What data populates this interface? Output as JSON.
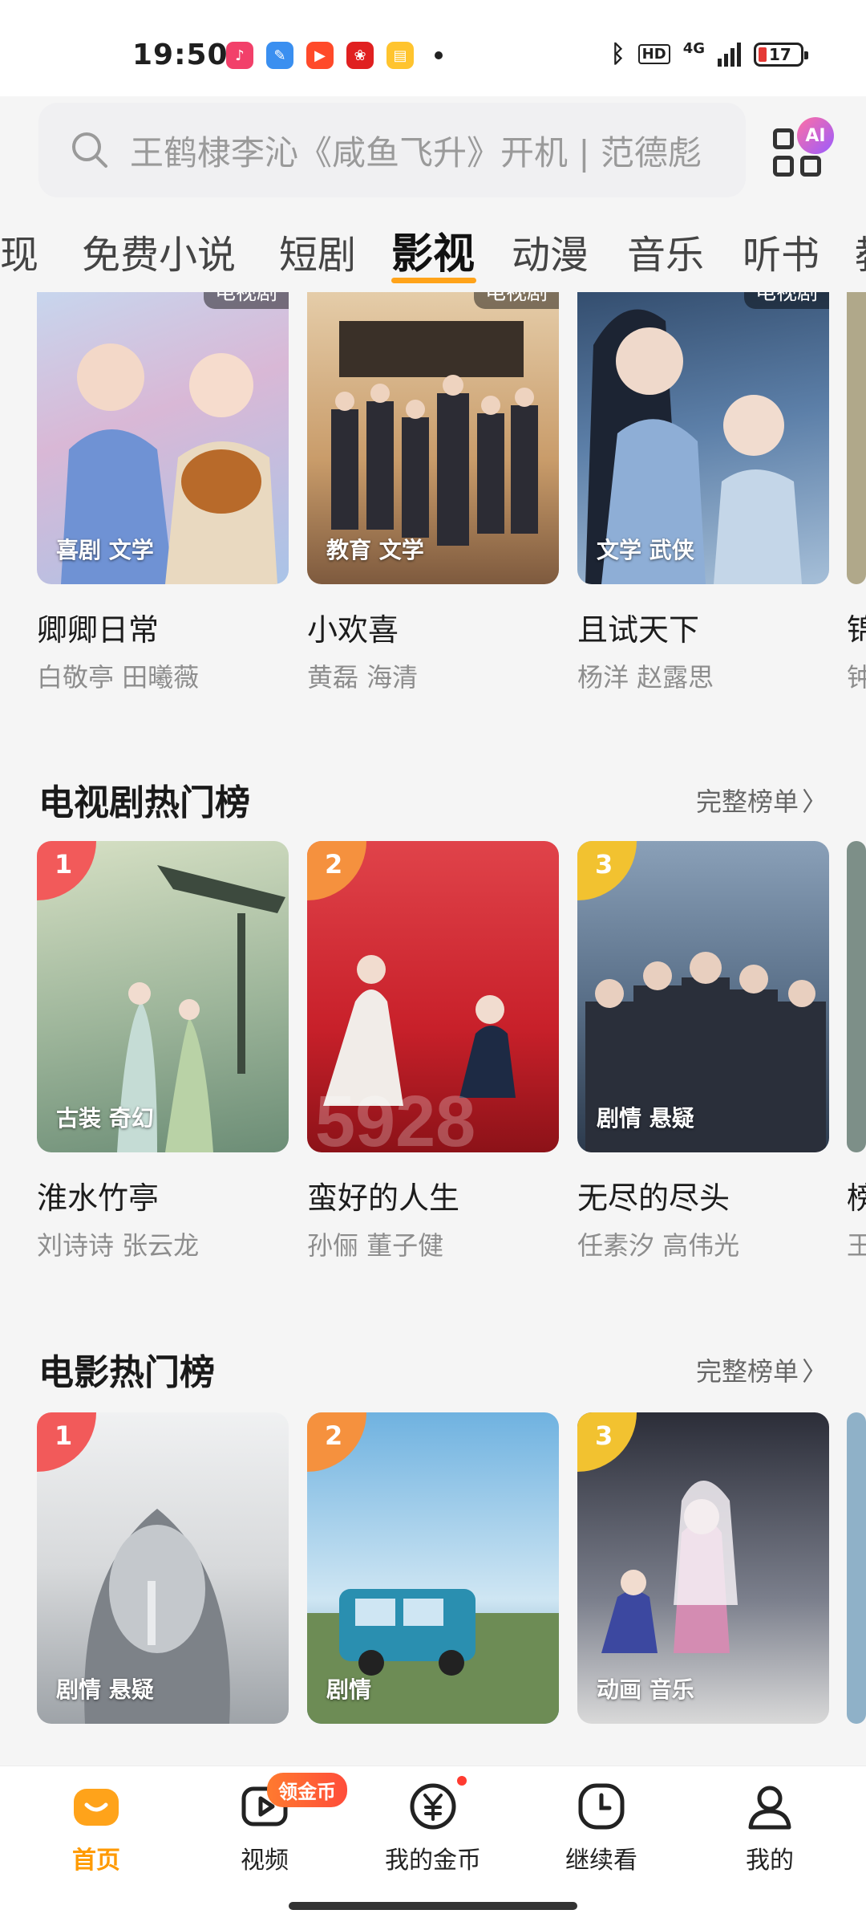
{
  "status_bar": {
    "time": "19:50",
    "network": "4G",
    "hd_label": "HD",
    "battery": "17",
    "app_icons": [
      "music-app-icon",
      "feather-app-icon",
      "video-app-icon",
      "pinduoduo-app-icon",
      "notes-app-icon"
    ]
  },
  "search": {
    "placeholder": "王鹤棣李沁《咸鱼飞升》开机 | 范德彪",
    "ai_badge": "AI"
  },
  "tabs": [
    "现",
    "免费小说",
    "短剧",
    "影视",
    "动漫",
    "音乐",
    "听书",
    "教"
  ],
  "active_tab": "影视",
  "top_row": {
    "items": [
      {
        "title": "卿卿日常",
        "cast": "白敬亭 田曦薇",
        "tags": "喜剧 文学",
        "badge": "电视剧",
        "colors": [
          "#a9c4e8",
          "#d9b8d6",
          "#c5d9f0"
        ]
      },
      {
        "title": "小欢喜",
        "cast": "黄磊 海清",
        "tags": "教育 文学",
        "badge": "电视剧",
        "colors": [
          "#c99c6a",
          "#e8d2b0",
          "#7e5a3e"
        ]
      },
      {
        "title": "且试天下",
        "cast": "杨洋 赵露思",
        "tags": "文学 武侠",
        "badge": "电视剧",
        "colors": [
          "#5c7fa8",
          "#a6bfd8",
          "#2f4868"
        ]
      },
      {
        "title": "锦",
        "cast": "钟"
      }
    ]
  },
  "tv_chart": {
    "heading": "电视剧热门榜",
    "more": "完整榜单",
    "items": [
      {
        "rank": "1",
        "title": "淮水竹亭",
        "cast": "刘诗诗 张云龙",
        "tags": "古装 奇幻",
        "colors": [
          "#9db59a",
          "#d6e0c4",
          "#6c8d76"
        ]
      },
      {
        "rank": "2",
        "title": "蛮好的人生",
        "cast": "孙俪 董子健",
        "tags": "",
        "colors": [
          "#c8202a",
          "#e0434a",
          "#8c1218"
        ]
      },
      {
        "rank": "3",
        "title": "无尽的尽头",
        "cast": "任素汐 高伟光",
        "tags": "剧情 悬疑",
        "colors": [
          "#5a7089",
          "#8aa0b8",
          "#2c3a4c"
        ]
      },
      {
        "title": "榜",
        "cast": "王"
      }
    ]
  },
  "movie_chart": {
    "heading": "电影热门榜",
    "more": "完整榜单",
    "items": [
      {
        "rank": "1",
        "tags": "剧情 悬疑",
        "colors": [
          "#d7d9db",
          "#9ea3a8",
          "#f0f1f2"
        ]
      },
      {
        "rank": "2",
        "tags": "剧情",
        "colors": [
          "#6fb2e0",
          "#cfe6f3",
          "#3f7fa8"
        ]
      },
      {
        "rank": "3",
        "tags": "动画 音乐",
        "colors": [
          "#7b7f8c",
          "#d48cb2",
          "#2b2d38"
        ]
      }
    ]
  },
  "rank_colors": [
    "#f25a5a",
    "#f5913e",
    "#f2c230"
  ],
  "bottom_nav": [
    {
      "label": "首页",
      "icon": "home-icon"
    },
    {
      "label": "视频",
      "icon": "video-play-icon",
      "pill": "领金币"
    },
    {
      "label": "我的金币",
      "icon": "yuan-coin-icon"
    },
    {
      "label": "继续看",
      "icon": "clock-icon"
    },
    {
      "label": "我的",
      "icon": "profile-icon"
    }
  ],
  "accent_color": "#ffa31a"
}
